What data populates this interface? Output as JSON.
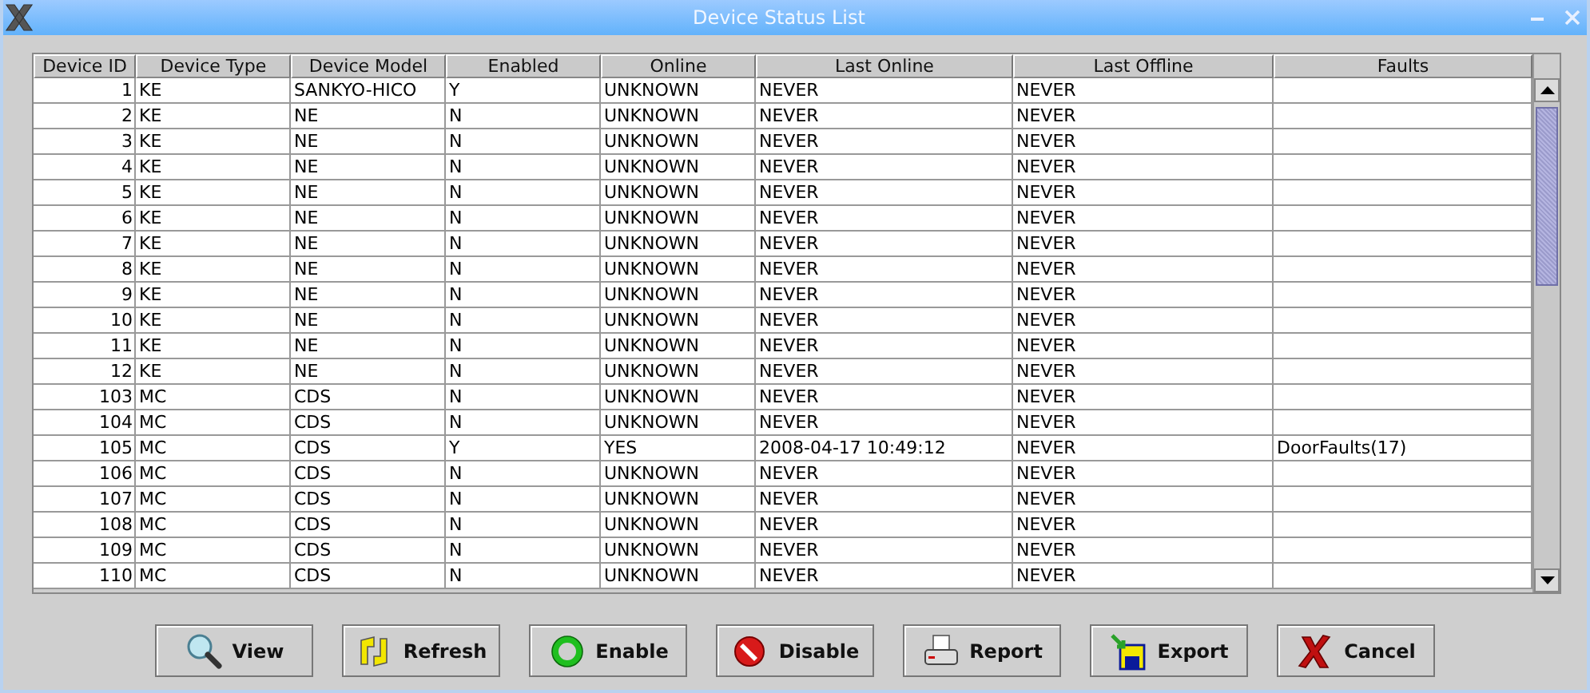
{
  "window": {
    "title": "Device Status List"
  },
  "table": {
    "columns": [
      "Device ID",
      "Device Type",
      "Device Model",
      "Enabled",
      "Online",
      "Last Online",
      "Last Offline",
      "Faults"
    ],
    "rows": [
      {
        "device_id": "1",
        "device_type": "KE",
        "device_model": "SANKYO-HICO",
        "enabled": "Y",
        "online": "UNKNOWN",
        "last_online": "NEVER",
        "last_offline": "NEVER"
      },
      {
        "device_id": "2",
        "device_type": "KE",
        "device_model": "NE",
        "enabled": "N",
        "online": "UNKNOWN",
        "last_online": "NEVER",
        "last_offline": "NEVER"
      },
      {
        "device_id": "3",
        "device_type": "KE",
        "device_model": "NE",
        "enabled": "N",
        "online": "UNKNOWN",
        "last_online": "NEVER",
        "last_offline": "NEVER"
      },
      {
        "device_id": "4",
        "device_type": "KE",
        "device_model": "NE",
        "enabled": "N",
        "online": "UNKNOWN",
        "last_online": "NEVER",
        "last_offline": "NEVER"
      },
      {
        "device_id": "5",
        "device_type": "KE",
        "device_model": "NE",
        "enabled": "N",
        "online": "UNKNOWN",
        "last_online": "NEVER",
        "last_offline": "NEVER"
      },
      {
        "device_id": "6",
        "device_type": "KE",
        "device_model": "NE",
        "enabled": "N",
        "online": "UNKNOWN",
        "last_online": "NEVER",
        "last_offline": "NEVER"
      },
      {
        "device_id": "7",
        "device_type": "KE",
        "device_model": "NE",
        "enabled": "N",
        "online": "UNKNOWN",
        "last_online": "NEVER",
        "last_offline": "NEVER"
      },
      {
        "device_id": "8",
        "device_type": "KE",
        "device_model": "NE",
        "enabled": "N",
        "online": "UNKNOWN",
        "last_online": "NEVER",
        "last_offline": "NEVER"
      },
      {
        "device_id": "9",
        "device_type": "KE",
        "device_model": "NE",
        "enabled": "N",
        "online": "UNKNOWN",
        "last_online": "NEVER",
        "last_offline": "NEVER"
      },
      {
        "device_id": "10",
        "device_type": "KE",
        "device_model": "NE",
        "enabled": "N",
        "online": "UNKNOWN",
        "last_online": "NEVER",
        "last_offline": "NEVER"
      },
      {
        "device_id": "11",
        "device_type": "KE",
        "device_model": "NE",
        "enabled": "N",
        "online": "UNKNOWN",
        "last_online": "NEVER",
        "last_offline": "NEVER"
      },
      {
        "device_id": "12",
        "device_type": "KE",
        "device_model": "NE",
        "enabled": "N",
        "online": "UNKNOWN",
        "last_online": "NEVER",
        "last_offline": "NEVER"
      },
      {
        "device_id": "103",
        "device_type": "MC",
        "device_model": "CDS",
        "enabled": "N",
        "online": "UNKNOWN",
        "last_online": "NEVER",
        "last_offline": "NEVER"
      },
      {
        "device_id": "104",
        "device_type": "MC",
        "device_model": "CDS",
        "enabled": "N",
        "online": "UNKNOWN",
        "last_online": "NEVER",
        "last_offline": "NEVER"
      },
      {
        "device_id": "105",
        "device_type": "MC",
        "device_model": "CDS",
        "enabled": "Y",
        "online": "YES",
        "last_online": "2008-04-17 10:49:12",
        "last_offline": "NEVER",
        "faults": "DoorFaults(17)"
      },
      {
        "device_id": "106",
        "device_type": "MC",
        "device_model": "CDS",
        "enabled": "N",
        "online": "UNKNOWN",
        "last_online": "NEVER",
        "last_offline": "NEVER"
      },
      {
        "device_id": "107",
        "device_type": "MC",
        "device_model": "CDS",
        "enabled": "N",
        "online": "UNKNOWN",
        "last_online": "NEVER",
        "last_offline": "NEVER"
      },
      {
        "device_id": "108",
        "device_type": "MC",
        "device_model": "CDS",
        "enabled": "N",
        "online": "UNKNOWN",
        "last_online": "NEVER",
        "last_offline": "NEVER"
      },
      {
        "device_id": "109",
        "device_type": "MC",
        "device_model": "CDS",
        "enabled": "N",
        "online": "UNKNOWN",
        "last_online": "NEVER",
        "last_offline": "NEVER"
      },
      {
        "device_id": "110",
        "device_type": "MC",
        "device_model": "CDS",
        "enabled": "N",
        "online": "UNKNOWN",
        "last_online": "NEVER",
        "last_offline": "NEVER"
      }
    ]
  },
  "buttons": [
    "View",
    "Refresh",
    "Enable",
    "Disable",
    "Report",
    "Export",
    "Cancel"
  ]
}
